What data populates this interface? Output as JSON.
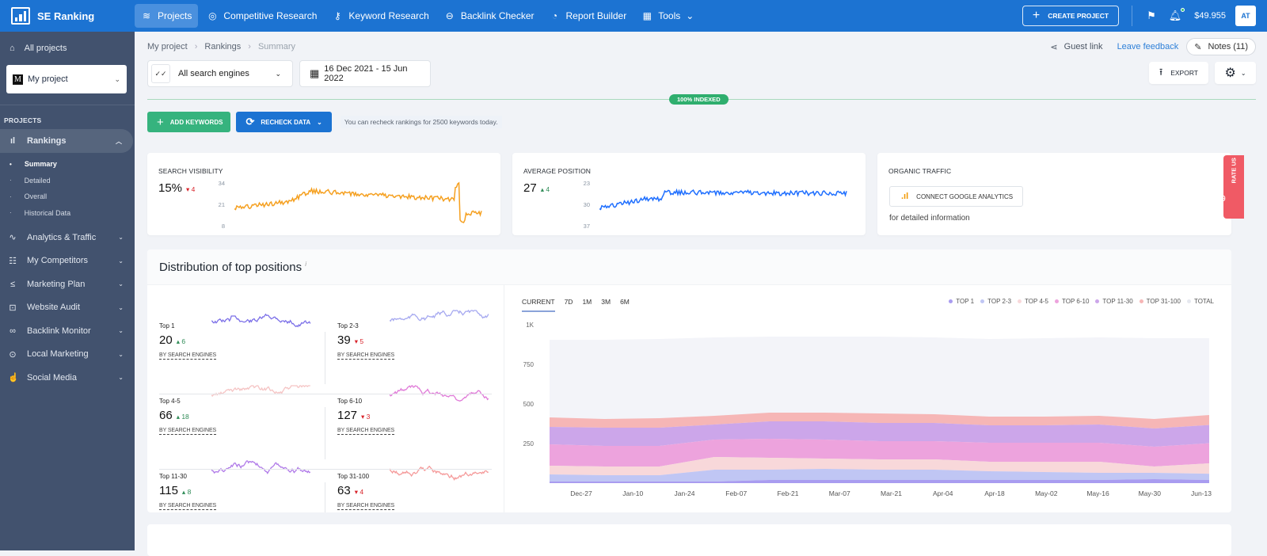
{
  "topbar": {
    "brand": "SE Ranking",
    "nav": [
      {
        "label": "Projects",
        "icon": "layers-icon",
        "glyph": "≋",
        "active": true
      },
      {
        "label": "Competitive Research",
        "icon": "target-icon",
        "glyph": "◎"
      },
      {
        "label": "Keyword Research",
        "icon": "key-icon",
        "glyph": "⚷"
      },
      {
        "label": "Backlink Checker",
        "icon": "link-icon",
        "glyph": "⊖"
      },
      {
        "label": "Report Builder",
        "icon": "pie-chart-icon",
        "glyph": "◔"
      },
      {
        "label": "Tools",
        "icon": "grid-icon",
        "glyph": "▦"
      }
    ],
    "create_project": "CREATE PROJECT",
    "balance": "$49.955",
    "avatar": "AT"
  },
  "sidebar": {
    "all_projects": "All projects",
    "project": "My project",
    "project_initial": "M",
    "section": "PROJECTS",
    "rankings": "Rankings",
    "subitems": [
      {
        "label": "Summary",
        "active": true
      },
      {
        "label": "Detailed"
      },
      {
        "label": "Overall"
      },
      {
        "label": "Historical Data"
      }
    ],
    "items": [
      {
        "label": "Analytics & Traffic",
        "glyph": "∿"
      },
      {
        "label": "My Competitors",
        "glyph": "☷"
      },
      {
        "label": "Marketing Plan",
        "glyph": "≤"
      },
      {
        "label": "Website Audit",
        "glyph": "⊡"
      },
      {
        "label": "Backlink Monitor",
        "glyph": "∞"
      },
      {
        "label": "Local Marketing",
        "glyph": "⊙"
      },
      {
        "label": "Social Media",
        "glyph": "☝"
      }
    ]
  },
  "breadcrumb": [
    "My project",
    "Rankings",
    "Summary"
  ],
  "header": {
    "guest_link": "Guest link",
    "leave_feedback": "Leave feedback",
    "notes": "Notes (11)",
    "export": "EXPORT"
  },
  "filters": {
    "engines": "All search engines",
    "date_range": "16 Dec 2021 - 15 Jun 2022"
  },
  "indexed_badge": "100% INDEXED",
  "actions": {
    "add_keywords": "ADD KEYWORDS",
    "recheck_data": "RECHECK DATA",
    "recheck_note": "You can recheck rankings for 2500 keywords today."
  },
  "cards": {
    "visibility": {
      "title": "SEARCH VISIBILITY",
      "value": "15%",
      "change": "4",
      "direction": "down",
      "axis": [
        "34",
        "21",
        "8"
      ],
      "color": "#f5a020"
    },
    "avg_position": {
      "title": "AVERAGE POSITION",
      "value": "27",
      "change": "4",
      "direction": "up",
      "axis": [
        "23",
        "30",
        "37"
      ],
      "color": "#1f6fff"
    },
    "organic": {
      "title": "ORGANIC TRAFFIC",
      "connect": "CONNECT GOOGLE ANALYTICS",
      "note": "for detailed information"
    }
  },
  "rate_us": "RATE US",
  "distribution": {
    "title": "Distribution of top positions",
    "info": "i",
    "by_label": "BY SEARCH ENGINES",
    "tiles": [
      {
        "label": "Top 1",
        "value": "20",
        "change": "6",
        "direction": "up",
        "color": "#7b6fe8"
      },
      {
        "label": "Top 2-3",
        "value": "39",
        "change": "5",
        "direction": "down",
        "color": "#a6a9f0"
      },
      {
        "label": "Top 4-5",
        "value": "66",
        "change": "18",
        "direction": "up",
        "color": "#f5c4c4"
      },
      {
        "label": "Top 6-10",
        "value": "127",
        "change": "3",
        "direction": "down",
        "color": "#e07ad8"
      },
      {
        "label": "Top 11-30",
        "value": "115",
        "change": "8",
        "direction": "up",
        "color": "#b07ae8"
      },
      {
        "label": "Top 31-100",
        "value": "63",
        "change": "4",
        "direction": "down",
        "color": "#f59a9a"
      }
    ],
    "tabs": [
      "CURRENT",
      "7D",
      "1M",
      "3M",
      "6M"
    ],
    "active_tab": "CURRENT"
  },
  "chart_data": {
    "type": "area",
    "title": "Distribution of top positions",
    "stacked": true,
    "xlabel": "",
    "ylabel": "",
    "ylim": [
      0,
      1000
    ],
    "y_ticks": [
      "250",
      "500",
      "750",
      "1K"
    ],
    "x_ticks": [
      "Dec-27",
      "Jan-10",
      "Jan-24",
      "Feb-07",
      "Feb-21",
      "Mar-07",
      "Mar-21",
      "Apr-04",
      "Apr-18",
      "May-02",
      "May-16",
      "May-30",
      "Jun-13"
    ],
    "legend_position": "top-right",
    "series": [
      {
        "name": "TOP 1",
        "color": "#a99cf0",
        "values": [
          10,
          10,
          10,
          10,
          20,
          20,
          20,
          20,
          20,
          20,
          20,
          25,
          20
        ]
      },
      {
        "name": "TOP 2-3",
        "color": "#c0c6f4",
        "values": [
          45,
          40,
          40,
          75,
          65,
          70,
          65,
          65,
          55,
          50,
          45,
          40,
          39
        ]
      },
      {
        "name": "TOP 4-5",
        "color": "#f8d8da",
        "values": [
          55,
          55,
          55,
          80,
          75,
          65,
          65,
          65,
          60,
          65,
          70,
          40,
          66
        ]
      },
      {
        "name": "TOP 6-10",
        "color": "#eda3dd",
        "values": [
          135,
          130,
          130,
          110,
          120,
          120,
          115,
          115,
          120,
          120,
          120,
          125,
          127
        ]
      },
      {
        "name": "TOP 11-30",
        "color": "#cca6ea",
        "values": [
          110,
          115,
          115,
          95,
          110,
          115,
          115,
          115,
          110,
          110,
          115,
          115,
          115
        ]
      },
      {
        "name": "TOP 31-100",
        "color": "#f6b6b6",
        "values": [
          60,
          55,
          60,
          55,
          55,
          55,
          60,
          55,
          55,
          55,
          55,
          60,
          63
        ]
      },
      {
        "name": "TOTAL",
        "color": "#f3f4f9",
        "values": [
          905,
          905,
          910,
          920,
          925,
          925,
          925,
          920,
          910,
          915,
          920,
          915,
          915
        ]
      }
    ]
  }
}
